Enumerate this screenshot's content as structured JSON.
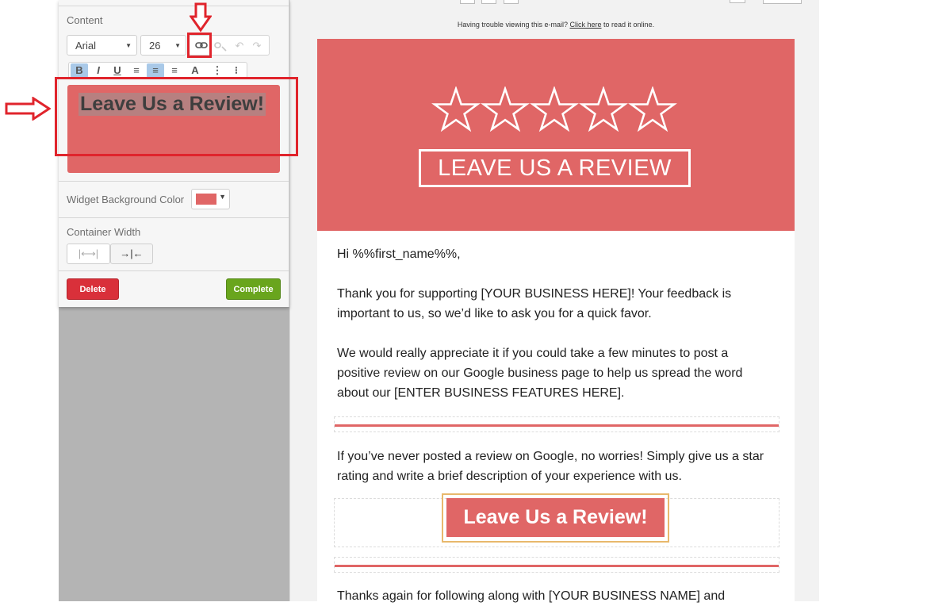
{
  "panel": {
    "content_label": "Content",
    "font_family": "Arial",
    "font_size": "26",
    "format_buttons": [
      {
        "label": "B",
        "active": true
      },
      {
        "label": "I",
        "active": false
      },
      {
        "label": "U",
        "active": false
      },
      {
        "label": "≡",
        "active": false
      },
      {
        "label": "≡",
        "active": true
      },
      {
        "label": "≡",
        "active": false
      },
      {
        "label": "A",
        "active": false
      },
      {
        "label": "⋮",
        "active": false
      },
      {
        "label": "⁝",
        "active": false
      }
    ],
    "preview_text": "Leave Us a Review!",
    "widget_bg_label": "Widget Background Color",
    "widget_bg_color": "#e06666",
    "container_width_label": "Container Width",
    "width_full_icon": "|⟷|",
    "width_fixed_icon": "→|←",
    "delete_label": "Delete",
    "complete_label": "Complete"
  },
  "email": {
    "trouble_prefix": "Having trouble viewing this e-mail?",
    "trouble_link": "Click here",
    "trouble_suffix": "to read it online.",
    "hero_text": "LEAVE US A REVIEW",
    "greeting": "Hi %%first_name%%,",
    "para1": "Thank you for supporting [YOUR BUSINESS HERE]! Your feedback is important to us, so we’d like to ask you for a quick favor.",
    "para2": "We would really appreciate it if you could take a few minutes to post a positive review on our Google business page to help us spread the word about our [ENTER BUSINESS FEATURES HERE].",
    "para3": "If you’ve never posted a review on Google, no worries! Simply give us a star rating and write a brief description of your experience with us.",
    "cta_label": "Leave Us a Review!",
    "para4": "Thanks again for following along with [YOUR BUSINESS NAME] and"
  },
  "colors": {
    "brand_red": "#e06666",
    "annotation_red": "#e0242c",
    "delete_red": "#d9303a",
    "complete_green": "#69a51d"
  }
}
